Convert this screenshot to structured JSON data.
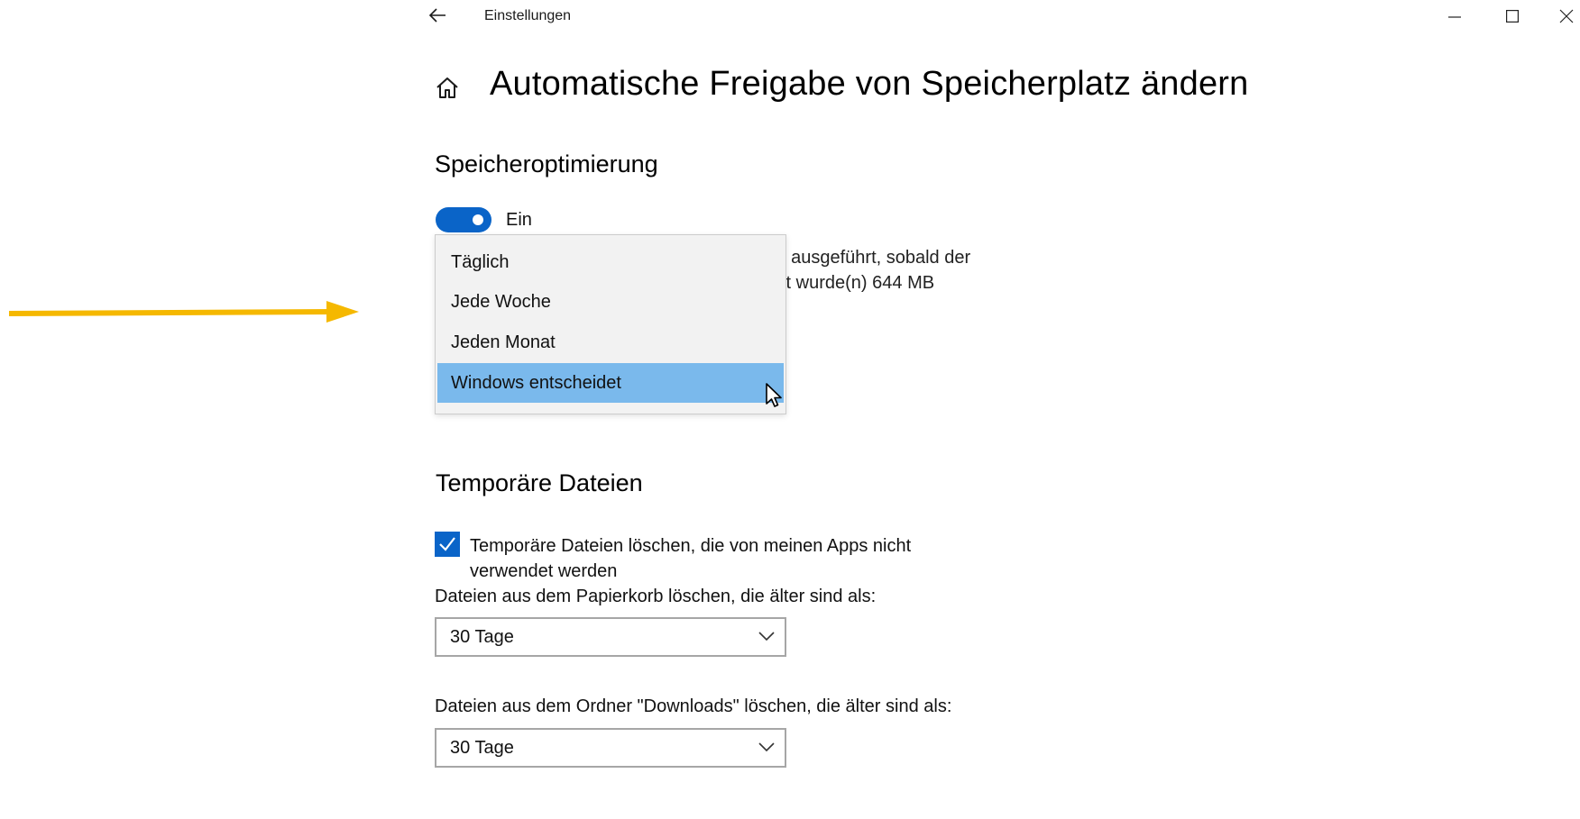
{
  "window": {
    "title": "Einstellungen",
    "controls": [
      "minimize-icon",
      "maximize-icon",
      "close-icon"
    ]
  },
  "page": {
    "title": "Automatische Freigabe von Speicherplatz ändern"
  },
  "storage_sense": {
    "heading": "Speicheroptimierung",
    "toggle_state": "on",
    "toggle_label": "Ein",
    "description_line1_visible": "ı ausgeführt, sobald der",
    "description_line2_visible": "ıt wurde(n) 644 MB"
  },
  "run_frequency_dropdown": {
    "expanded": true,
    "options": [
      "Täglich",
      "Jede Woche",
      "Jeden Monat",
      "Windows entscheidet"
    ],
    "highlighted": "Windows entscheidet"
  },
  "temp_files": {
    "heading": "Temporäre Dateien",
    "checkbox_checked": true,
    "checkbox_label": "Temporäre Dateien löschen, die von meinen Apps nicht verwendet werden",
    "recycle_bin_label": "Dateien aus dem Papierkorb löschen, die älter sind als:",
    "recycle_bin_value": "30 Tage",
    "downloads_label": "Dateien aus dem Ordner \"Downloads\" löschen, die älter sind als:",
    "downloads_value": "30 Tage"
  },
  "colors": {
    "accent": "#0a64c8",
    "flyout_highlight": "#7ab9ec",
    "flyout_background": "#f2f2f2",
    "annotation_arrow": "#f5b800"
  },
  "icons": {
    "back": "back-arrow-icon",
    "home": "home-icon",
    "chevron": "chevron-down-icon",
    "pointer": "mouse-pointer-icon",
    "annotation": "yellow-arrow-annotation"
  }
}
